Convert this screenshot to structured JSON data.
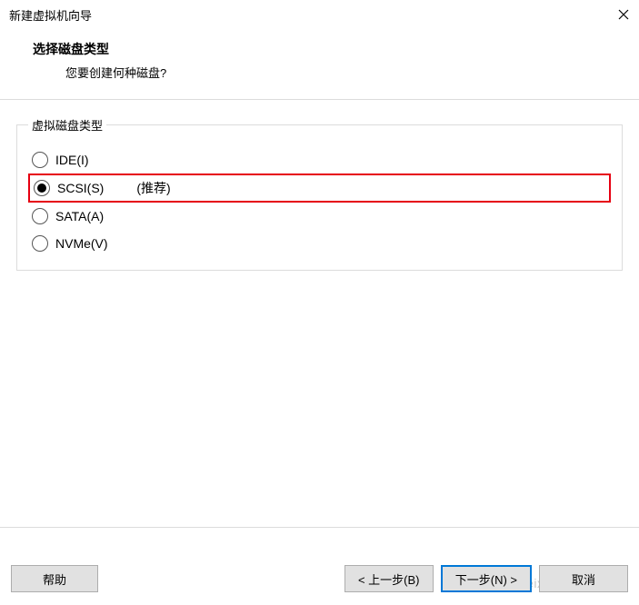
{
  "window": {
    "title": "新建虚拟机向导"
  },
  "header": {
    "title": "选择磁盘类型",
    "subtitle": "您要创建何种磁盘?"
  },
  "group": {
    "legend": "虚拟磁盘类型",
    "options": {
      "ide": {
        "label": "IDE(I)"
      },
      "scsi": {
        "label": "SCSI(S)",
        "suffix": "(推荐)"
      },
      "sata": {
        "label": "SATA(A)"
      },
      "nvme": {
        "label": "NVMe(V)"
      }
    }
  },
  "buttons": {
    "help": "帮助",
    "back": "< 上一步(B)",
    "next": "下一步(N) >",
    "cancel": "取消"
  },
  "watermark": "CSDN @weixin_71436237"
}
